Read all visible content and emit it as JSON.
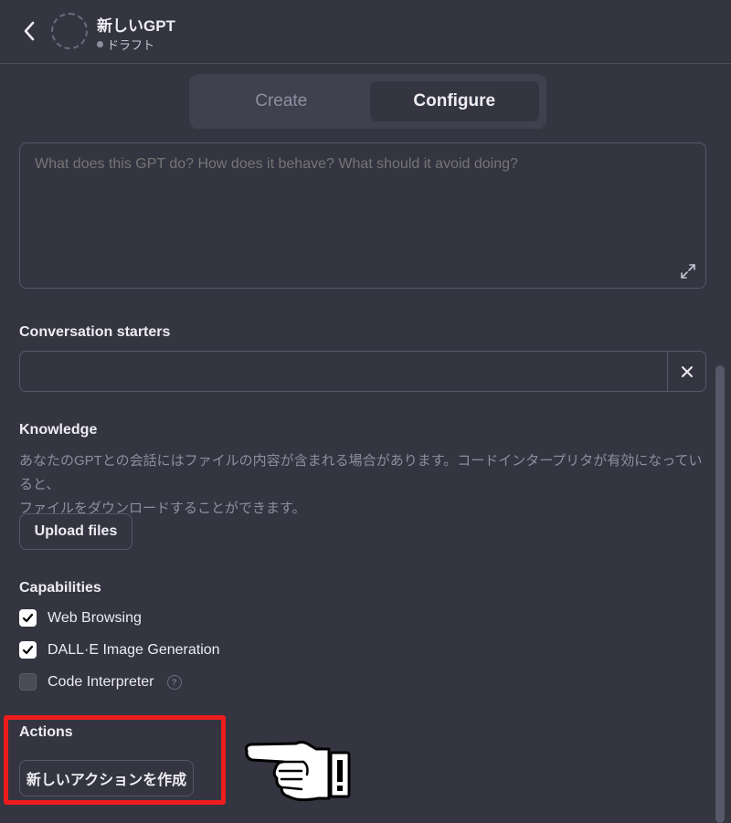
{
  "header": {
    "back_icon": "chevron-left-icon",
    "gpt_name": "新しいGPT",
    "status": "ドラフト"
  },
  "tabs": [
    {
      "label": "Create",
      "active": false
    },
    {
      "label": "Configure",
      "active": true
    }
  ],
  "instructions": {
    "value": "",
    "placeholder": "What does this GPT do? How does it behave? What should it avoid doing?"
  },
  "conversation_starters": {
    "label": "Conversation starters",
    "value": "",
    "clear_icon": "close-icon"
  },
  "knowledge": {
    "label": "Knowledge",
    "description_line1": "あなたのGPTとの会話にはファイルの内容が含まれる場合があります。コードインタープリタが有効になっていると、",
    "description_line2": "ファイルをダウンロードすることができます。",
    "upload_label": "Upload files"
  },
  "capabilities": {
    "label": "Capabilities",
    "items": [
      {
        "label": "Web Browsing",
        "checked": true
      },
      {
        "label": "DALL·E Image Generation",
        "checked": true
      },
      {
        "label": "Code Interpreter",
        "checked": false,
        "help": "?"
      }
    ]
  },
  "actions": {
    "label": "Actions",
    "create_label": "新しいアクションを作成"
  },
  "colors": {
    "background": "#343541",
    "highlight": "#ee1c1c"
  }
}
